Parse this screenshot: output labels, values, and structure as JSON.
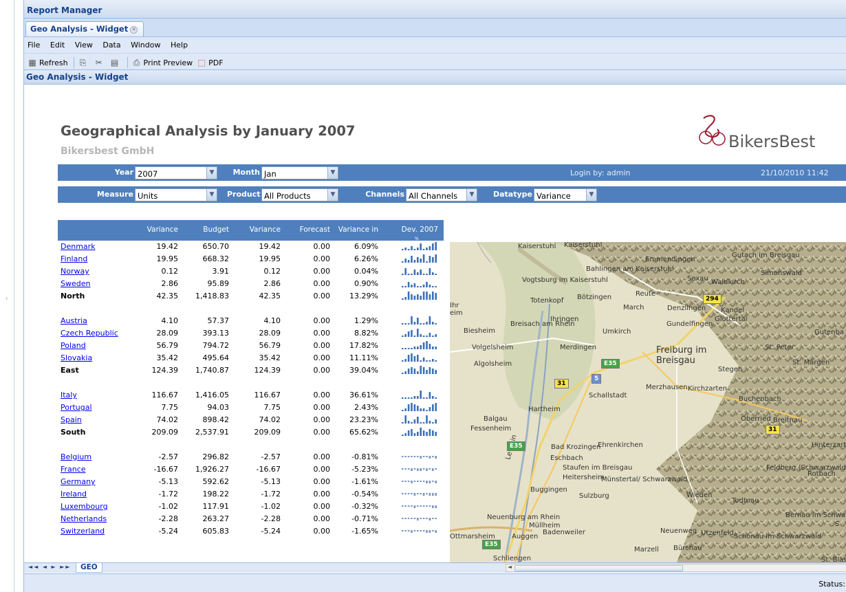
{
  "app": {
    "title": "Report Manager"
  },
  "tabs": [
    {
      "label": "Geo Analysis - Widget"
    }
  ],
  "menu": [
    "File",
    "Edit",
    "View",
    "Data",
    "Window",
    "Help"
  ],
  "toolbar": {
    "refresh": "Refresh",
    "print_preview": "Print Preview",
    "pdf": "PDF"
  },
  "panel": {
    "title": "Geo Analysis - Widget"
  },
  "report": {
    "title": "Geographical Analysis by January 2007",
    "subtitle": "Bikersbest GmbH",
    "logo_text": "BikersBest"
  },
  "filters": {
    "year": {
      "label": "Year",
      "value": "2007"
    },
    "month": {
      "label": "Month",
      "value": "Jan"
    },
    "login": "Login by: admin",
    "datetime": "21/10/2010 11:42",
    "measure": {
      "label": "Measure",
      "value": "Units"
    },
    "product": {
      "label": "Product",
      "value": "All Products"
    },
    "channels": {
      "label": "Channels",
      "value": "All Channels"
    },
    "datatype": {
      "label": "Datatype",
      "value": "Variance"
    }
  },
  "table": {
    "headers": [
      "Variance",
      "Budget",
      "Variance",
      "Forecast",
      "Variance in",
      "Dev. 2007"
    ],
    "header_small": "%",
    "rows": [
      {
        "name": "Denmark",
        "link": true,
        "v": [
          "19.42",
          "650.70",
          "19.42",
          "0.00",
          "6.09%"
        ],
        "spark": [
          1,
          2,
          1,
          3,
          1,
          2,
          5,
          1,
          2,
          3,
          5,
          6
        ]
      },
      {
        "name": "Finland",
        "link": true,
        "v": [
          "19.95",
          "668.32",
          "19.95",
          "0.00",
          "6.26%"
        ],
        "spark": [
          1,
          3,
          2,
          5,
          2,
          4,
          3,
          6,
          1,
          5,
          4,
          6
        ]
      },
      {
        "name": "Norway",
        "link": true,
        "v": [
          "0.12",
          "3.91",
          "0.12",
          "0.00",
          "0.04%"
        ],
        "spark": [
          1,
          5,
          1,
          1,
          4,
          2,
          4,
          1,
          1,
          5,
          2,
          1
        ]
      },
      {
        "name": "Sweden",
        "link": true,
        "v": [
          "2.86",
          "95.89",
          "2.86",
          "0.00",
          "0.90%"
        ],
        "spark": [
          1,
          1,
          4,
          2,
          3,
          1,
          1,
          2,
          4,
          2,
          1,
          1
        ]
      },
      {
        "name": "North",
        "total": true,
        "v": [
          "42.35",
          "1,418.83",
          "42.35",
          "0.00",
          "13.29%"
        ],
        "spark": [
          1,
          2,
          6,
          4,
          3,
          4,
          3,
          6,
          6,
          4,
          6,
          5
        ]
      },
      {
        "name": "Austria",
        "link": true,
        "v": [
          "4.10",
          "57.37",
          "4.10",
          "0.00",
          "1.29%"
        ],
        "spark": [
          1,
          1,
          1,
          6,
          2,
          5,
          1,
          1,
          2,
          6,
          2,
          1
        ]
      },
      {
        "name": "Czech Republic",
        "link": true,
        "v": [
          "28.09",
          "393.13",
          "28.09",
          "0.00",
          "8.82%"
        ],
        "spark": [
          1,
          2,
          4,
          5,
          1,
          6,
          2,
          1,
          1,
          3,
          1,
          2
        ]
      },
      {
        "name": "Poland",
        "link": true,
        "v": [
          "56.79",
          "794.72",
          "56.79",
          "0.00",
          "17.82%"
        ],
        "spark": [
          1,
          1,
          1,
          1,
          2,
          2,
          3,
          5,
          6,
          4,
          2,
          2
        ]
      },
      {
        "name": "Slovakia",
        "link": true,
        "v": [
          "35.42",
          "495.64",
          "35.42",
          "0.00",
          "11.11%"
        ],
        "spark": [
          1,
          2,
          5,
          6,
          4,
          5,
          1,
          3,
          1,
          1,
          2,
          1
        ]
      },
      {
        "name": "East",
        "total": true,
        "v": [
          "124.39",
          "1,740.87",
          "124.39",
          "0.00",
          "39.04%"
        ],
        "spark": [
          1,
          2,
          4,
          5,
          4,
          2,
          6,
          5,
          3,
          5,
          4,
          3
        ]
      },
      {
        "name": "Italy",
        "link": true,
        "v": [
          "116.67",
          "1,416.05",
          "116.67",
          "0.00",
          "36.61%"
        ],
        "spark": [
          1,
          1,
          1,
          1,
          2,
          2,
          6,
          1,
          1,
          5,
          2,
          1
        ]
      },
      {
        "name": "Portugal",
        "link": true,
        "v": [
          "7.75",
          "94.03",
          "7.75",
          "0.00",
          "2.43%"
        ],
        "spark": [
          1,
          2,
          5,
          6,
          5,
          4,
          2,
          2,
          1,
          3,
          5,
          6
        ]
      },
      {
        "name": "Spain",
        "link": true,
        "v": [
          "74.02",
          "898.42",
          "74.02",
          "0.00",
          "23.23%"
        ],
        "spark": [
          1,
          6,
          2,
          1,
          3,
          5,
          1,
          1,
          6,
          2,
          1,
          3
        ]
      },
      {
        "name": "South",
        "total": true,
        "v": [
          "209.09",
          "2,537.91",
          "209.09",
          "0.00",
          "65.62%"
        ],
        "spark": [
          1,
          2,
          4,
          5,
          2,
          3,
          6,
          4,
          3,
          5,
          4,
          3
        ]
      },
      {
        "name": "Belgium",
        "link": true,
        "v": [
          "-2.57",
          "296.82",
          "-2.57",
          "0.00",
          "-0.81%"
        ],
        "spark": [
          -1,
          -1,
          -1,
          -1,
          -1,
          -1,
          -2,
          -1,
          -1,
          -2,
          -1,
          -2
        ]
      },
      {
        "name": "France",
        "link": true,
        "v": [
          "-16.67",
          "1,926.27",
          "-16.67",
          "0.00",
          "-5.23%"
        ],
        "spark": [
          -1,
          -1,
          -1,
          -2,
          -1,
          -2,
          -2,
          -1,
          -2,
          -1,
          -2,
          -1
        ]
      },
      {
        "name": "Germany",
        "link": true,
        "v": [
          "-5.13",
          "592.62",
          "-5.13",
          "0.00",
          "-1.61%"
        ],
        "spark": [
          -1,
          -1,
          -1,
          -2,
          -1,
          -1,
          -1,
          -1,
          -2,
          -2,
          -1,
          -2
        ]
      },
      {
        "name": "Ireland",
        "link": true,
        "v": [
          "-1.72",
          "198.22",
          "-1.72",
          "0.00",
          "-0.54%"
        ],
        "spark": [
          -1,
          -1,
          -1,
          -1,
          -2,
          -1,
          -1,
          -2,
          -1,
          -2,
          -2,
          -2
        ]
      },
      {
        "name": "Luxembourg",
        "link": true,
        "v": [
          "-1.02",
          "117.91",
          "-1.02",
          "0.00",
          "-0.32%"
        ],
        "spark": [
          -1,
          -1,
          -1,
          -1,
          -2,
          -1,
          -1,
          -1,
          -1,
          -1,
          -2,
          -2
        ]
      },
      {
        "name": "Netherlands",
        "link": true,
        "v": [
          "-2.28",
          "263.27",
          "-2.28",
          "0.00",
          "-0.71%"
        ],
        "spark": [
          -1,
          -1,
          -1,
          -1,
          -1,
          -2,
          -1,
          -1,
          -1,
          -2,
          -1,
          -1
        ]
      },
      {
        "name": "Switzerland",
        "link": true,
        "v": [
          "-5.24",
          "605.83",
          "-5.24",
          "0.00",
          "-1.65%"
        ],
        "spark": [
          -1,
          -1,
          -1,
          -2,
          -1,
          -1,
          -1,
          -1,
          -2,
          -2,
          -1,
          -2
        ]
      }
    ]
  },
  "map": {
    "labels": [
      "Kaiserstuhl",
      "Kaiserstuhl",
      "Emmendingen",
      "Gutach im Breisgau",
      "Bahlingen am Kaiserstuhl",
      "Sexau",
      "Simonswald",
      "Vogtsburg im Kaiserstuhl",
      "Waldkirch",
      "Totenkopf",
      "Bötzingen",
      "Reute",
      "Ihr",
      "eim",
      "March",
      "Denzlingen",
      "Kandel",
      "Ihringen",
      "Glottertal",
      "Gundelfingen",
      "Breisach am Rhein",
      "Biesheim",
      "Umkirch",
      "Gutenba",
      "Volgelsheim",
      "Merdingen",
      "Freiburg im Breisgau",
      "St. Peter",
      "Algolsheim",
      "St. Märgen",
      "Stegen",
      "Merzhausen",
      "Kirchzarten",
      "Schallstadt",
      "Buchenbach",
      "Hartheim",
      "Oberried",
      "Breitnau",
      "Balgau",
      "Fessenheim",
      "Ehrenkirchen",
      "Bad Krozingen",
      "Hinterzarten",
      "Staufen im Breisgau",
      "Eschbach",
      "Heitersheim",
      "Münstertal/ Schwarzwald",
      "Rotbach",
      "Feldberg (Schwarzwald)",
      "Buggingen",
      "Wieden",
      "Sulzburg",
      "Todtnau",
      "Neuenburg am Rhein",
      "Müllheim",
      "Bernau im Schwarzwald",
      "Ottmarsheim",
      "Auggen",
      "Badenweiler",
      "Neuenweg",
      "Utzenfeld",
      "Schönau im Schwarzwald",
      "Marzell",
      "Bürchau",
      "Schliengen",
      "St. Blasien",
      "Fröhnd",
      "Le Rhin",
      "S"
    ],
    "shields": [
      "294",
      "E35",
      "5",
      "31",
      "31",
      "E35",
      "E35"
    ]
  },
  "sheet_tab": "GEO",
  "status": "Status:"
}
